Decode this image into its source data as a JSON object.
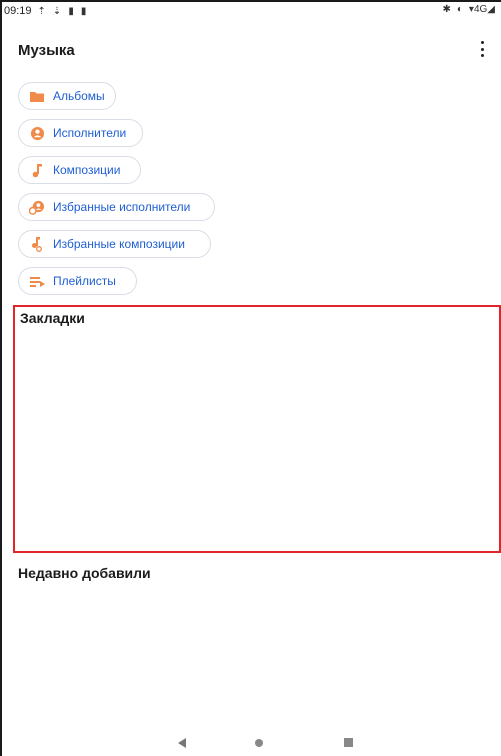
{
  "status_bar": {
    "time": "09:19",
    "left_icons": [
      "upload-icon",
      "download-icon",
      "sim-icon",
      "battery-icon"
    ],
    "right_icons": [
      "bluetooth-icon",
      "data-saver-icon",
      "signal-icon"
    ],
    "network_label": "4G"
  },
  "app_bar": {
    "title": "Музыка",
    "menu_icon": "more-vert-icon"
  },
  "chips": [
    {
      "label": "Альбомы",
      "icon": "folder-icon"
    },
    {
      "label": "Исполнители",
      "icon": "person-icon"
    },
    {
      "label": "Композиции",
      "icon": "music-note-icon"
    },
    {
      "label": "Избранные исполнители",
      "icon": "favorite-artist-icon"
    },
    {
      "label": "Избранные композиции",
      "icon": "favorite-song-icon"
    },
    {
      "label": "Плейлисты",
      "icon": "playlist-icon"
    }
  ],
  "sections": {
    "bookmarks": "Закладки",
    "recently_added": "Недавно добавили"
  },
  "colors": {
    "accent": "#F08A4B",
    "chip_text": "#1F5FD1",
    "highlight_border": "#E0252B"
  },
  "nav_bar": {
    "buttons": [
      "back-icon",
      "home-icon",
      "recents-icon"
    ]
  }
}
